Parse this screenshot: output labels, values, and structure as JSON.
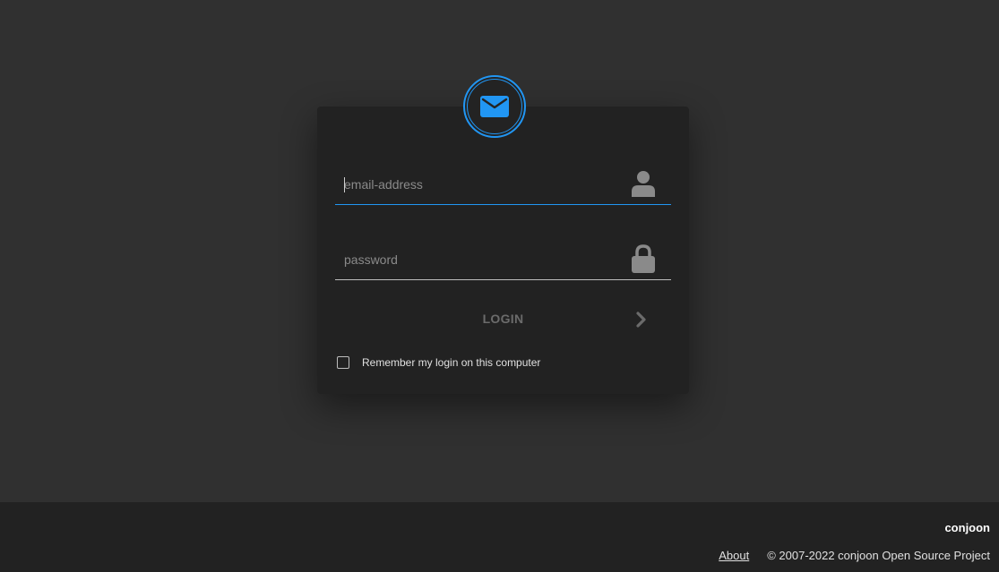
{
  "login": {
    "email_placeholder": "email-address",
    "password_placeholder": "password",
    "login_label": "LOGIN",
    "remember_label": "Remember my login on this computer",
    "remember_checked": false
  },
  "icons": {
    "logo": "envelope-icon",
    "email_field": "user-icon",
    "password_field": "lock-icon",
    "login_arrow": "chevron-right-icon"
  },
  "footer": {
    "brand": "conjoon",
    "about_label": "About",
    "copyright": "© 2007-2022 conjoon Open Source Project"
  },
  "colors": {
    "accent": "#2196f3",
    "background": "#303030",
    "card": "#222222",
    "footer": "#222222"
  }
}
